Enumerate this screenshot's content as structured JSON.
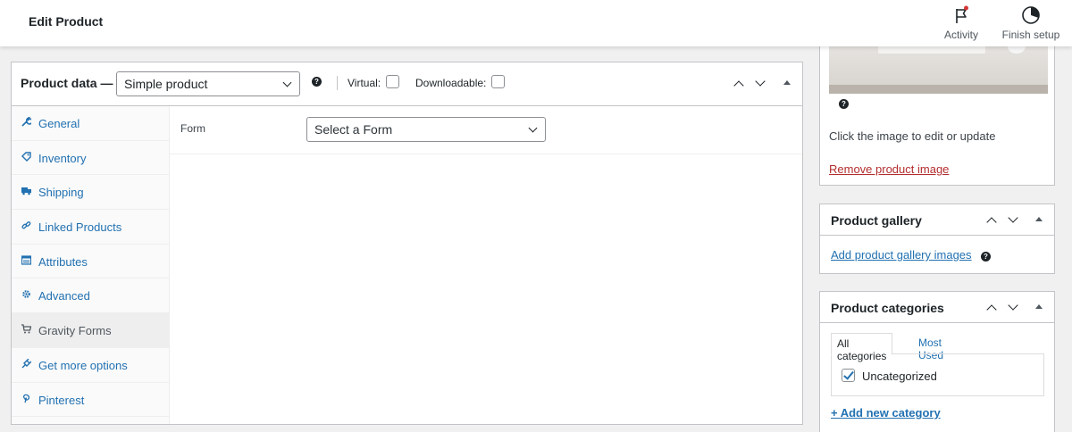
{
  "header": {
    "title": "Edit Product",
    "activity_label": "Activity",
    "finish_setup_label": "Finish setup"
  },
  "product_data": {
    "title": "Product data —",
    "type_selected": "Simple product",
    "help_glyph": "?",
    "virtual_label": "Virtual:",
    "virtual_checked": false,
    "downloadable_label": "Downloadable:",
    "downloadable_checked": false,
    "tabs": [
      {
        "label": "General",
        "icon": "wrench-icon"
      },
      {
        "label": "Inventory",
        "icon": "tag-icon"
      },
      {
        "label": "Shipping",
        "icon": "truck-icon"
      },
      {
        "label": "Linked Products",
        "icon": "link-icon"
      },
      {
        "label": "Attributes",
        "icon": "list-icon"
      },
      {
        "label": "Advanced",
        "icon": "gear-icon"
      },
      {
        "label": "Gravity Forms",
        "icon": "cart-icon",
        "active": true
      },
      {
        "label": "Get more options",
        "icon": "plugin-icon"
      },
      {
        "label": "Pinterest",
        "icon": "pinterest-icon"
      }
    ],
    "form": {
      "label": "Form",
      "selected": "Select a Form"
    }
  },
  "product_image": {
    "help_glyph": "?",
    "edit_hint": "Click the image to edit or update",
    "remove_link": "Remove product image"
  },
  "product_gallery": {
    "title": "Product gallery",
    "add_link": "Add product gallery images",
    "help_glyph": "?"
  },
  "product_categories": {
    "title": "Product categories",
    "tab_all": "All categories",
    "tab_most_used": "Most Used",
    "items": [
      {
        "label": "Uncategorized",
        "checked": true
      }
    ],
    "add_link": "+ Add new category"
  },
  "colors": {
    "link": "#2271b1",
    "remove_link": "#b32d2e",
    "border": "#c3c4c7",
    "background": "#f0f0f1",
    "notification_dot": "#d63638"
  }
}
